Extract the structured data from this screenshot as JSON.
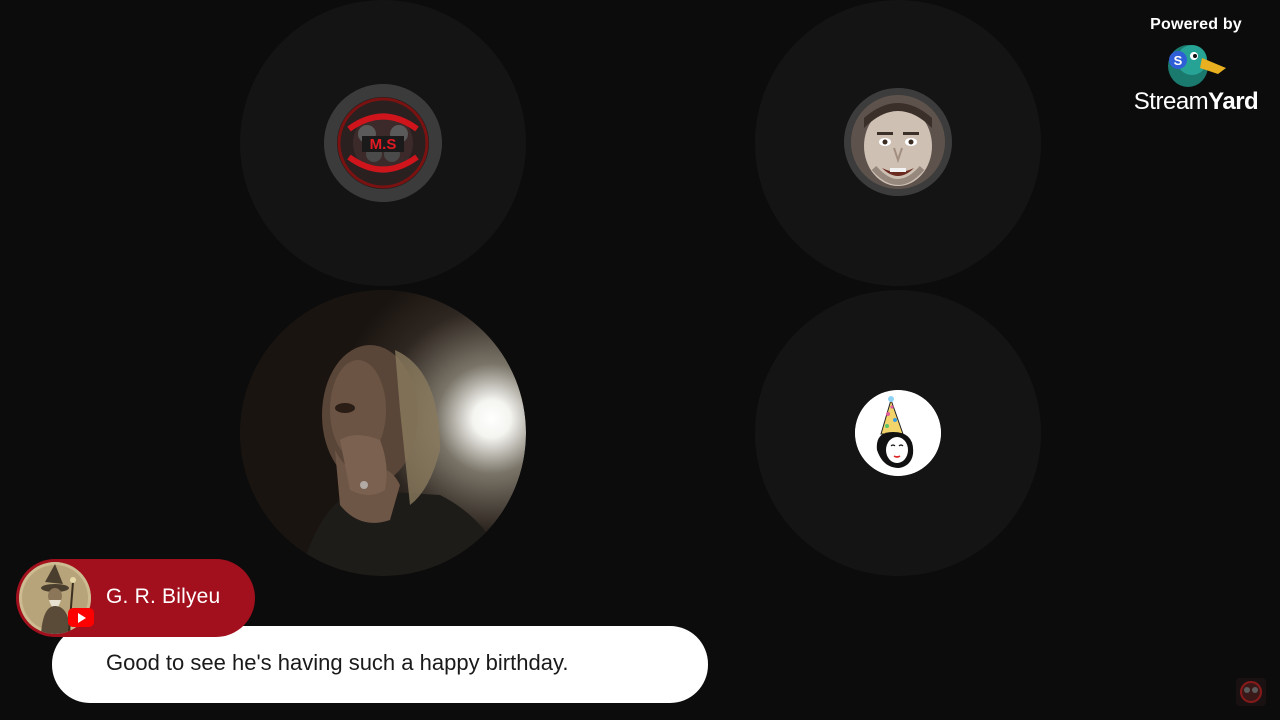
{
  "branding": {
    "powered_by": "Powered by",
    "brand_name_light": "Stream",
    "brand_name_bold": "Yard",
    "logo_icon": "duck-logo-icon"
  },
  "participants": [
    {
      "slot": 1,
      "avatar": "williams-storybook-logo-avatar",
      "badge_text": "M.S"
    },
    {
      "slot": 2,
      "avatar": "smiling-man-avatar"
    },
    {
      "slot": 3,
      "avatar": "live-camera-feed",
      "active": true
    },
    {
      "slot": 4,
      "avatar": "party-hat-cartoon-avatar"
    }
  ],
  "comment": {
    "author": "G. R. Bilyeu",
    "platform": "youtube-icon",
    "text": "Good to see he's having such a happy birthday.",
    "accent_color": "#a3101d"
  },
  "colors": {
    "background": "#0c0c0c",
    "tile": "#141414",
    "comment_accent": "#a3101d",
    "youtube_red": "#ff0000"
  }
}
